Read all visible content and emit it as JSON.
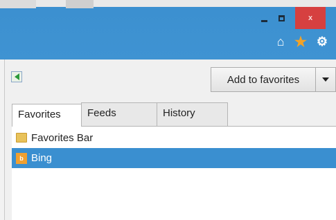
{
  "window": {
    "minimize_glyph": "",
    "close_glyph": "x"
  },
  "toolbar": {
    "icons": [
      "home-icon",
      "favorites-star-icon",
      "gear-icon"
    ],
    "accent_color": "#3f93d2"
  },
  "favorites_panel": {
    "add_button_label": "Add to favorites",
    "tabs": [
      {
        "label": "Favorites",
        "selected": true
      },
      {
        "label": "Feeds",
        "selected": false
      },
      {
        "label": "History",
        "selected": false
      }
    ],
    "items": [
      {
        "label": "Favorites Bar",
        "icon": "folder-icon",
        "selected": false
      },
      {
        "label": "Bing",
        "icon": "bing-icon",
        "selected": true
      }
    ],
    "selection_color": "#3a8fd0"
  }
}
